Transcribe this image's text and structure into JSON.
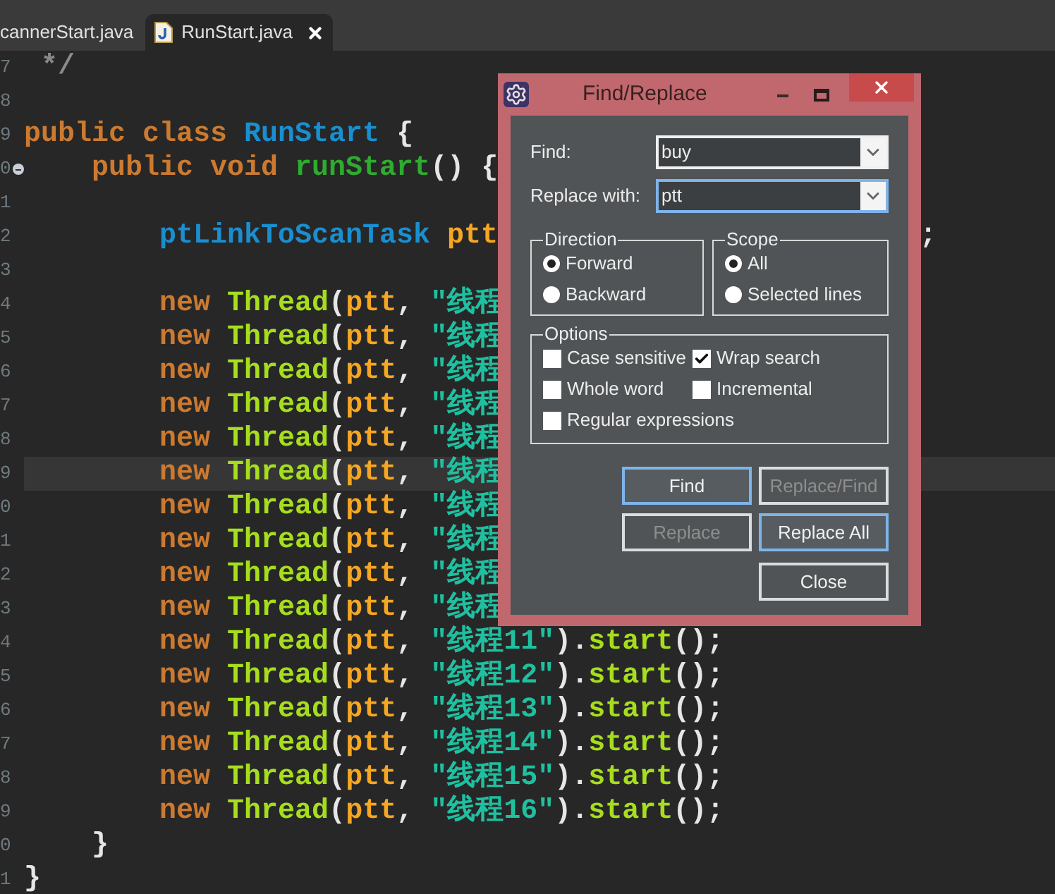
{
  "tabs": [
    {
      "label": "cannerStart.java",
      "selected": false
    },
    {
      "label": "RunStart.java",
      "selected": true
    }
  ],
  "editor": {
    "lines": [
      {
        "number": "7",
        "current": false,
        "tokens": [
          {
            "text": " */",
            "kind": "comment"
          }
        ]
      },
      {
        "number": "8",
        "current": false
      },
      {
        "number": "9",
        "current": false,
        "tokens": [
          {
            "text": "public class",
            "kind": "keyword"
          },
          {
            "text": " RunStart",
            "kind": "type"
          },
          {
            "text": " {",
            "kind": "punct"
          }
        ]
      },
      {
        "number": "0",
        "current": false,
        "fold": true,
        "tokens": [
          {
            "text": "    public void",
            "kind": "keyword"
          },
          {
            "text": " runStart",
            "kind": "method"
          },
          {
            "text": "() {",
            "kind": "punct"
          }
        ]
      },
      {
        "number": "1",
        "current": false
      },
      {
        "number": "2",
        "current": false,
        "tokens": [
          {
            "text": "        ptLinkToScanTask",
            "kind": "type"
          },
          {
            "text": " ptt",
            "kind": "var"
          }
        ],
        "tail": ";"
      },
      {
        "number": "3",
        "current": false
      },
      {
        "number": "4",
        "current": false,
        "tokens": [
          {
            "text": "        new",
            "kind": "keyword"
          },
          {
            "text": " Thread",
            "kind": "call"
          },
          {
            "text": "(",
            "kind": "punct"
          },
          {
            "text": "ptt",
            "kind": "var"
          },
          {
            "text": ", ",
            "kind": "punct"
          },
          {
            "text": "\"线程",
            "kind": "string"
          }
        ]
      },
      {
        "number": "5",
        "current": false,
        "tokens": [
          {
            "text": "        new",
            "kind": "keyword"
          },
          {
            "text": " Thread",
            "kind": "call"
          },
          {
            "text": "(",
            "kind": "punct"
          },
          {
            "text": "ptt",
            "kind": "var"
          },
          {
            "text": ", ",
            "kind": "punct"
          },
          {
            "text": "\"线程",
            "kind": "string"
          }
        ]
      },
      {
        "number": "6",
        "current": false,
        "tokens": [
          {
            "text": "        new",
            "kind": "keyword"
          },
          {
            "text": " Thread",
            "kind": "call"
          },
          {
            "text": "(",
            "kind": "punct"
          },
          {
            "text": "ptt",
            "kind": "var"
          },
          {
            "text": ", ",
            "kind": "punct"
          },
          {
            "text": "\"线程",
            "kind": "string"
          }
        ]
      },
      {
        "number": "7",
        "current": false,
        "tokens": [
          {
            "text": "        new",
            "kind": "keyword"
          },
          {
            "text": " Thread",
            "kind": "call"
          },
          {
            "text": "(",
            "kind": "punct"
          },
          {
            "text": "ptt",
            "kind": "var"
          },
          {
            "text": ", ",
            "kind": "punct"
          },
          {
            "text": "\"线程",
            "kind": "string"
          }
        ]
      },
      {
        "number": "8",
        "current": false,
        "tokens": [
          {
            "text": "        new",
            "kind": "keyword"
          },
          {
            "text": " Thread",
            "kind": "call"
          },
          {
            "text": "(",
            "kind": "punct"
          },
          {
            "text": "ptt",
            "kind": "var"
          },
          {
            "text": ", ",
            "kind": "punct"
          },
          {
            "text": "\"线程",
            "kind": "string"
          }
        ]
      },
      {
        "number": "9",
        "current": true,
        "tokens": [
          {
            "text": "        new",
            "kind": "keyword"
          },
          {
            "text": " Thread",
            "kind": "call"
          },
          {
            "text": "(",
            "kind": "punct"
          },
          {
            "text": "ptt",
            "kind": "var"
          },
          {
            "text": ", ",
            "kind": "punct"
          },
          {
            "text": "\"线程",
            "kind": "string"
          }
        ]
      },
      {
        "number": "0",
        "current": false,
        "tokens": [
          {
            "text": "        new",
            "kind": "keyword"
          },
          {
            "text": " Thread",
            "kind": "call"
          },
          {
            "text": "(",
            "kind": "punct"
          },
          {
            "text": "ptt",
            "kind": "var"
          },
          {
            "text": ", ",
            "kind": "punct"
          },
          {
            "text": "\"线程",
            "kind": "string"
          }
        ]
      },
      {
        "number": "1",
        "current": false,
        "tokens": [
          {
            "text": "        new",
            "kind": "keyword"
          },
          {
            "text": " Thread",
            "kind": "call"
          },
          {
            "text": "(",
            "kind": "punct"
          },
          {
            "text": "ptt",
            "kind": "var"
          },
          {
            "text": ", ",
            "kind": "punct"
          },
          {
            "text": "\"线程",
            "kind": "string"
          }
        ]
      },
      {
        "number": "2",
        "current": false,
        "tokens": [
          {
            "text": "        new",
            "kind": "keyword"
          },
          {
            "text": " Thread",
            "kind": "call"
          },
          {
            "text": "(",
            "kind": "punct"
          },
          {
            "text": "ptt",
            "kind": "var"
          },
          {
            "text": ", ",
            "kind": "punct"
          },
          {
            "text": "\"线程",
            "kind": "string"
          }
        ]
      },
      {
        "number": "3",
        "current": false,
        "tokens": [
          {
            "text": "        new",
            "kind": "keyword"
          },
          {
            "text": " Thread",
            "kind": "call"
          },
          {
            "text": "(",
            "kind": "punct"
          },
          {
            "text": "ptt",
            "kind": "var"
          },
          {
            "text": ", ",
            "kind": "punct"
          },
          {
            "text": "\"线程",
            "kind": "string"
          }
        ]
      },
      {
        "number": "4",
        "current": false,
        "tokens": [
          {
            "text": "        new",
            "kind": "keyword"
          },
          {
            "text": " Thread",
            "kind": "call"
          },
          {
            "text": "(",
            "kind": "punct"
          },
          {
            "text": "ptt",
            "kind": "var"
          },
          {
            "text": ", ",
            "kind": "punct"
          },
          {
            "text": "\"线程11\"",
            "kind": "string"
          },
          {
            "text": ").",
            "kind": "punct"
          },
          {
            "text": "start",
            "kind": "call"
          },
          {
            "text": "();",
            "kind": "punct"
          }
        ]
      },
      {
        "number": "5",
        "current": false,
        "tokens": [
          {
            "text": "        new",
            "kind": "keyword"
          },
          {
            "text": " Thread",
            "kind": "call"
          },
          {
            "text": "(",
            "kind": "punct"
          },
          {
            "text": "ptt",
            "kind": "var"
          },
          {
            "text": ", ",
            "kind": "punct"
          },
          {
            "text": "\"线程12\"",
            "kind": "string"
          },
          {
            "text": ").",
            "kind": "punct"
          },
          {
            "text": "start",
            "kind": "call"
          },
          {
            "text": "();",
            "kind": "punct"
          }
        ]
      },
      {
        "number": "6",
        "current": false,
        "tokens": [
          {
            "text": "        new",
            "kind": "keyword"
          },
          {
            "text": " Thread",
            "kind": "call"
          },
          {
            "text": "(",
            "kind": "punct"
          },
          {
            "text": "ptt",
            "kind": "var"
          },
          {
            "text": ", ",
            "kind": "punct"
          },
          {
            "text": "\"线程13\"",
            "kind": "string"
          },
          {
            "text": ").",
            "kind": "punct"
          },
          {
            "text": "start",
            "kind": "call"
          },
          {
            "text": "();",
            "kind": "punct"
          }
        ]
      },
      {
        "number": "7",
        "current": false,
        "tokens": [
          {
            "text": "        new",
            "kind": "keyword"
          },
          {
            "text": " Thread",
            "kind": "call"
          },
          {
            "text": "(",
            "kind": "punct"
          },
          {
            "text": "ptt",
            "kind": "var"
          },
          {
            "text": ", ",
            "kind": "punct"
          },
          {
            "text": "\"线程14\"",
            "kind": "string"
          },
          {
            "text": ").",
            "kind": "punct"
          },
          {
            "text": "start",
            "kind": "call"
          },
          {
            "text": "();",
            "kind": "punct"
          }
        ]
      },
      {
        "number": "8",
        "current": false,
        "tokens": [
          {
            "text": "        new",
            "kind": "keyword"
          },
          {
            "text": " Thread",
            "kind": "call"
          },
          {
            "text": "(",
            "kind": "punct"
          },
          {
            "text": "ptt",
            "kind": "var"
          },
          {
            "text": ", ",
            "kind": "punct"
          },
          {
            "text": "\"线程15\"",
            "kind": "string"
          },
          {
            "text": ").",
            "kind": "punct"
          },
          {
            "text": "start",
            "kind": "call"
          },
          {
            "text": "();",
            "kind": "punct"
          }
        ]
      },
      {
        "number": "9",
        "current": false,
        "tokens": [
          {
            "text": "        new",
            "kind": "keyword"
          },
          {
            "text": " Thread",
            "kind": "call"
          },
          {
            "text": "(",
            "kind": "punct"
          },
          {
            "text": "ptt",
            "kind": "var"
          },
          {
            "text": ", ",
            "kind": "punct"
          },
          {
            "text": "\"线程16\"",
            "kind": "string"
          },
          {
            "text": ").",
            "kind": "punct"
          },
          {
            "text": "start",
            "kind": "call"
          },
          {
            "text": "();",
            "kind": "punct"
          }
        ]
      },
      {
        "number": "0",
        "current": false,
        "tokens": [
          {
            "text": "    }",
            "kind": "punct"
          }
        ]
      },
      {
        "number": "1",
        "current": false,
        "tokens": [
          {
            "text": "}",
            "kind": "punct"
          }
        ]
      }
    ]
  },
  "dialog": {
    "title": "Find/Replace",
    "find": {
      "label": "Find:",
      "value": "buy",
      "focused": false
    },
    "replace": {
      "label": "Replace with:",
      "value": "ptt",
      "focused": true
    },
    "direction": {
      "title": "Direction",
      "options": [
        {
          "label": "Forward",
          "selected": true
        },
        {
          "label": "Backward",
          "selected": false
        }
      ]
    },
    "scope": {
      "title": "Scope",
      "options": [
        {
          "label": "All",
          "selected": true
        },
        {
          "label": "Selected lines",
          "selected": false
        }
      ]
    },
    "options": {
      "title": "Options",
      "items": [
        {
          "label": "Case sensitive",
          "checked": false
        },
        {
          "label": "Wrap search",
          "checked": true
        },
        {
          "label": "Whole word",
          "checked": false
        },
        {
          "label": "Incremental",
          "checked": false
        },
        {
          "label": "Regular expressions",
          "checked": false
        }
      ]
    },
    "buttons": [
      {
        "label": "Find",
        "disabled": false,
        "focused": true
      },
      {
        "label": "Replace/Find",
        "disabled": true,
        "focused": false
      },
      {
        "label": "Replace",
        "disabled": true,
        "focused": false
      },
      {
        "label": "Replace All",
        "disabled": false,
        "focused": true
      }
    ],
    "close": {
      "label": "Close"
    }
  }
}
